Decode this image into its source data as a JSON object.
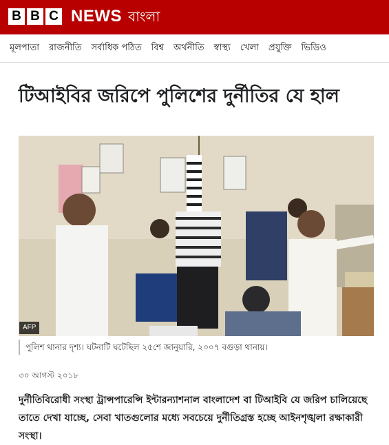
{
  "header": {
    "logo_letters": [
      "B",
      "B",
      "C"
    ],
    "news_word": "NEWS",
    "language": "বাংলা",
    "brand_color": "#b80000"
  },
  "nav": {
    "items": [
      "মূলপাতা",
      "রাজনীতি",
      "সর্বাধিক পঠিত",
      "বিশ্ব",
      "অর্থনীতি",
      "স্বাস্থ্য",
      "খেলা",
      "প্রযুক্তি",
      "ভিডিও"
    ]
  },
  "article": {
    "headline": "টিআইবির জরিপে পুলিশের দুর্নীতির যে হাল",
    "image_credit": "AFP",
    "caption": "পুলিশ থানার দৃশ্য। ঘটনাটি ঘটেছিল ২৫শে জানুয়ারি, ২০০৭ বগুড়া থানায়।",
    "date": "৩০ আগস্ট ২০১৮",
    "lead": "দুর্নীতিবিরোধী সংস্থা ট্রান্সপারেন্সি ইন্টারন্যাশনাল বাংলাদেশ বা টিআইবি যে জরিপ চালিয়েছে তাতে দেখা যাচ্ছে, সেবা খাতগুলোর মধ্যে সবচেয়ে দুর্নীতিগ্রস্ত হচ্ছে আইনশৃঙ্খলা রক্ষাকারী সংস্থা।"
  }
}
